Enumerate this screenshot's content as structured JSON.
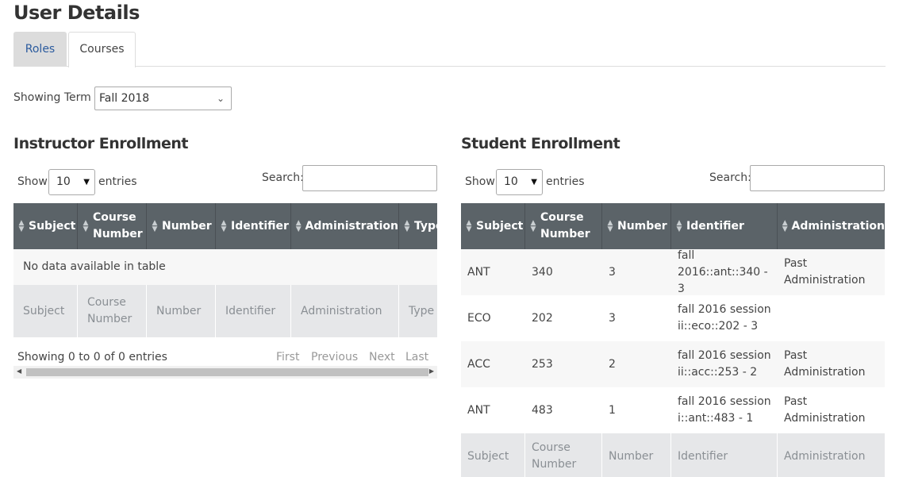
{
  "page_title": "User Details",
  "tabs": [
    {
      "label": "Roles"
    },
    {
      "label": "Courses"
    }
  ],
  "term": {
    "label": "Showing Term",
    "selected": "Fall 2018"
  },
  "instructor": {
    "title": "Instructor Enrollment",
    "show": "Show",
    "page_length": "10",
    "entries": "entries",
    "search_label": "Search:",
    "columns": [
      "Subject",
      "Course Number",
      "Number",
      "Identifier",
      "Administration",
      "Type"
    ],
    "empty_message": "No data available in table",
    "info": "Showing 0 to 0 of 0 entries",
    "pager": {
      "first": "First",
      "previous": "Previous",
      "next": "Next",
      "last": "Last"
    }
  },
  "student": {
    "title": "Student Enrollment",
    "show": "Show",
    "page_length": "10",
    "entries": "entries",
    "search_label": "Search:",
    "columns": [
      "Subject",
      "Course Number",
      "Number",
      "Identifier",
      "Administration"
    ],
    "rows": [
      {
        "subject": "ANT",
        "course_number": "340",
        "number": "3",
        "identifier": "fall 2016::ant::340 - 3",
        "administration": "Past Administration"
      },
      {
        "subject": "ECO",
        "course_number": "202",
        "number": "3",
        "identifier": "fall 2016 session ii::eco::202 - 3",
        "administration": ""
      },
      {
        "subject": "ACC",
        "course_number": "253",
        "number": "2",
        "identifier": "fall 2016 session ii::acc::253 - 2",
        "administration": "Past Administration"
      },
      {
        "subject": "ANT",
        "course_number": "483",
        "number": "1",
        "identifier": "fall 2016 session i::ant::483 - 1",
        "administration": "Past Administration"
      }
    ]
  }
}
